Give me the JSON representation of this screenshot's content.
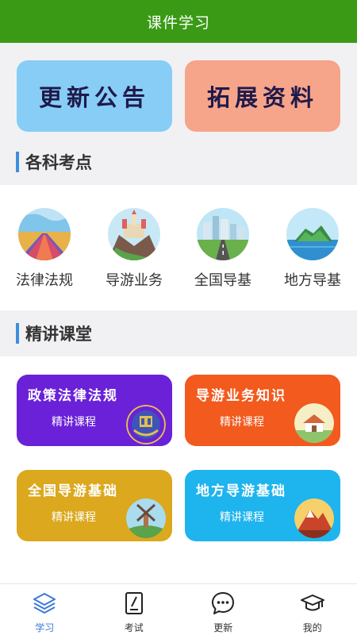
{
  "header": {
    "title": "课件学习"
  },
  "banners": {
    "notice": "更新公告",
    "materials": "拓展资料"
  },
  "sections": {
    "topics": "各科考点",
    "lectures": "精讲课堂"
  },
  "categories": [
    {
      "label": "法律法规",
      "icon": "road-sunset-icon"
    },
    {
      "label": "导游业务",
      "icon": "castle-mountain-icon"
    },
    {
      "label": "全国导基",
      "icon": "city-road-icon"
    },
    {
      "label": "地方导基",
      "icon": "island-icon"
    }
  ],
  "cards": [
    {
      "title": "政策法律法规",
      "subtitle": "精讲课程",
      "color": "#6a21d8",
      "icon": "emblem-icon"
    },
    {
      "title": "导游业务知识",
      "subtitle": "精讲课程",
      "color": "#f25a1e",
      "icon": "house-icon"
    },
    {
      "title": "全国导游基础",
      "subtitle": "精讲课程",
      "color": "#dba81e",
      "icon": "windmill-icon"
    },
    {
      "title": "地方导游基础",
      "subtitle": "精讲课程",
      "color": "#1eb4ee",
      "icon": "mountain-icon"
    }
  ],
  "tabs": [
    {
      "label": "学习",
      "icon": "layers-icon",
      "active": true
    },
    {
      "label": "考试",
      "icon": "exam-icon",
      "active": false
    },
    {
      "label": "更新",
      "icon": "chat-icon",
      "active": false
    },
    {
      "label": "我的",
      "icon": "graduation-cap-icon",
      "active": false
    }
  ],
  "colors": {
    "header": "#3a9a16",
    "accent": "#3c78d8"
  }
}
